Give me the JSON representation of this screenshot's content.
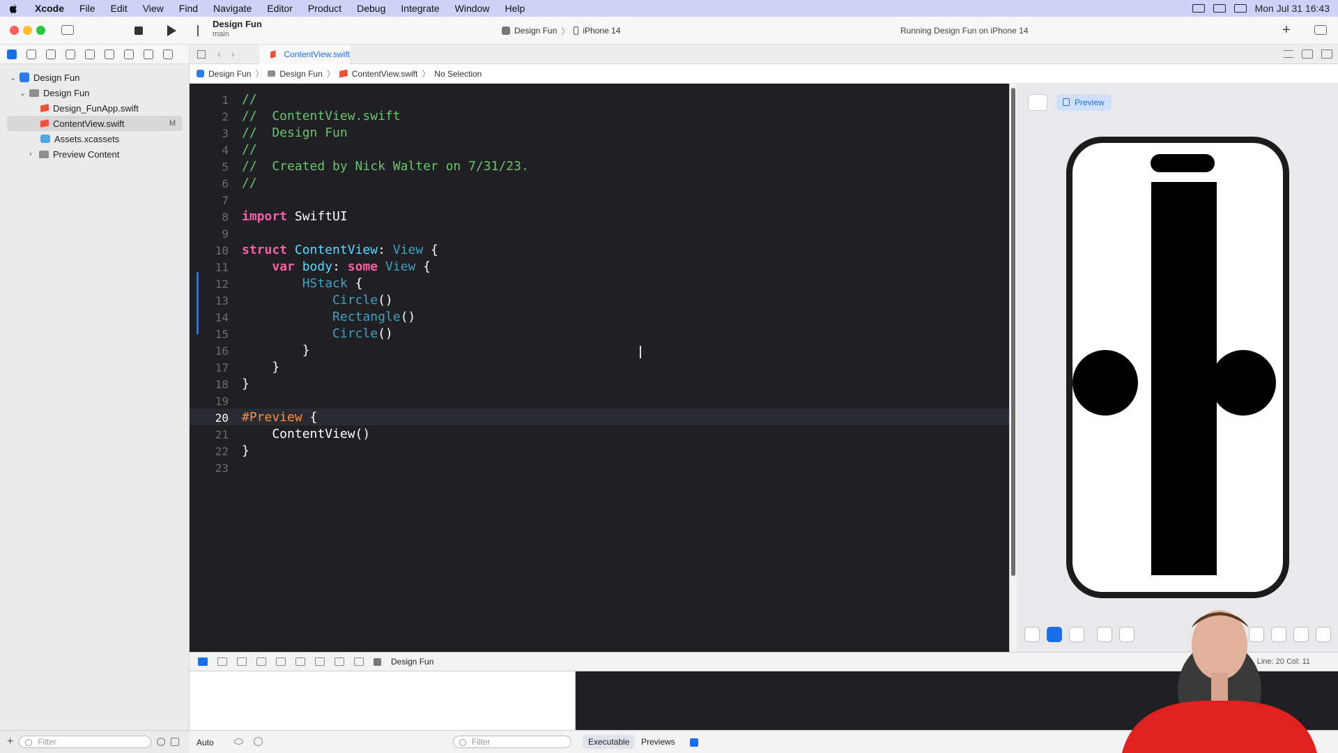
{
  "menubar": {
    "app": "Xcode",
    "items": [
      "File",
      "Edit",
      "View",
      "Find",
      "Navigate",
      "Editor",
      "Product",
      "Debug",
      "Integrate",
      "Window",
      "Help"
    ],
    "clock": "Mon Jul 31  16:43"
  },
  "toolbar": {
    "project_title": "Design Fun",
    "branch": "main",
    "scheme": "Design Fun",
    "destination": "iPhone 14",
    "status": "Running Design Fun on iPhone 14"
  },
  "tab": {
    "label": "ContentView.swift"
  },
  "breadcrumb": [
    "Design Fun",
    "Design Fun",
    "ContentView.swift",
    "No Selection"
  ],
  "navigator": {
    "items": [
      {
        "label": "Design Fun",
        "kind": "project"
      },
      {
        "label": "Design Fun",
        "kind": "folder"
      },
      {
        "label": "Design_FunApp.swift",
        "kind": "swift"
      },
      {
        "label": "ContentView.swift",
        "kind": "swift",
        "badge": "M"
      },
      {
        "label": "Assets.xcassets",
        "kind": "assets"
      },
      {
        "label": "Preview Content",
        "kind": "folder"
      }
    ],
    "filter_placeholder": "Filter"
  },
  "editor": {
    "line_numbers": [
      "1",
      "2",
      "3",
      "4",
      "5",
      "6",
      "7",
      "8",
      "9",
      "10",
      "11",
      "12",
      "13",
      "14",
      "15",
      "16",
      "17",
      "18",
      "19",
      "20",
      "21",
      "22",
      "23"
    ],
    "current_line": "20",
    "lines": [
      {
        "t": [
          [
            "cm",
            "//"
          ]
        ]
      },
      {
        "t": [
          [
            "cm",
            "//  ContentView.swift"
          ]
        ]
      },
      {
        "t": [
          [
            "cm",
            "//  Design Fun"
          ]
        ]
      },
      {
        "t": [
          [
            "cm",
            "//"
          ]
        ]
      },
      {
        "t": [
          [
            "cm",
            "//  Created by Nick Walter on 7/31/23."
          ]
        ]
      },
      {
        "t": [
          [
            "cm",
            "//"
          ]
        ]
      },
      {
        "t": []
      },
      {
        "t": [
          [
            "kw",
            "import"
          ],
          [
            "pl",
            " SwiftUI"
          ]
        ]
      },
      {
        "t": []
      },
      {
        "t": [
          [
            "kw",
            "struct"
          ],
          [
            "pl",
            " "
          ],
          [
            "ty",
            "ContentView"
          ],
          [
            "pl",
            ": "
          ],
          [
            "tp",
            "View"
          ],
          [
            "pl",
            " {"
          ]
        ]
      },
      {
        "t": [
          [
            "pl",
            "    "
          ],
          [
            "kw",
            "var"
          ],
          [
            "pl",
            " "
          ],
          [
            "ty",
            "body"
          ],
          [
            "pl",
            ": "
          ],
          [
            "kw",
            "some"
          ],
          [
            "pl",
            " "
          ],
          [
            "tp",
            "View"
          ],
          [
            "pl",
            " {"
          ]
        ]
      },
      {
        "t": [
          [
            "pl",
            "        "
          ],
          [
            "tp",
            "HStack"
          ],
          [
            "pl",
            " {"
          ]
        ]
      },
      {
        "t": [
          [
            "pl",
            "            "
          ],
          [
            "tp",
            "Circle"
          ],
          [
            "pl",
            "()"
          ]
        ]
      },
      {
        "t": [
          [
            "pl",
            "            "
          ],
          [
            "tp",
            "Rectangle"
          ],
          [
            "pl",
            "()"
          ]
        ]
      },
      {
        "t": [
          [
            "pl",
            "            "
          ],
          [
            "tp",
            "Circle"
          ],
          [
            "pl",
            "()"
          ]
        ]
      },
      {
        "t": [
          [
            "pl",
            "        }"
          ]
        ]
      },
      {
        "t": [
          [
            "pl",
            "    }"
          ]
        ]
      },
      {
        "t": [
          [
            "pl",
            "}"
          ]
        ]
      },
      {
        "t": []
      },
      {
        "t": [
          [
            "mc",
            "#Preview"
          ],
          [
            "pl",
            " {"
          ]
        ]
      },
      {
        "t": [
          [
            "pl",
            "    ContentView()"
          ]
        ]
      },
      {
        "t": [
          [
            "pl",
            "}"
          ]
        ]
      },
      {
        "t": []
      }
    ]
  },
  "preview": {
    "button_label": "Preview"
  },
  "debug": {
    "target": "Design Fun",
    "cursor_pos": "Line: 20  Col: 11"
  },
  "bottombar": {
    "auto": "Auto",
    "filter_placeholder": "Filter",
    "tab_executable": "Executable",
    "tab_previews": "Previews"
  }
}
